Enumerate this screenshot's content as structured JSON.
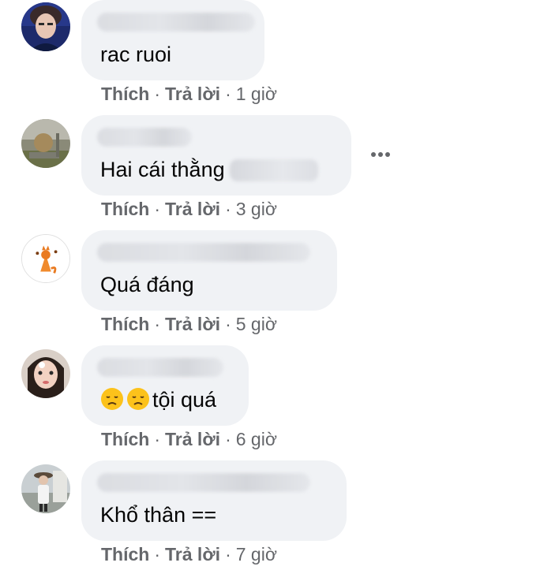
{
  "comments": [
    {
      "text": "rac ruoi",
      "like": "Thích",
      "reply": "Trả lời",
      "time": "1 giờ",
      "avatar_icon": "avatar-young-man-icon"
    },
    {
      "text": "Hai cái thằng",
      "like": "Thích",
      "reply": "Trả lời",
      "time": "3 giờ",
      "avatar_icon": "avatar-stone-sculpture-icon"
    },
    {
      "text": "Quá đáng",
      "like": "Thích",
      "reply": "Trả lời",
      "time": "5 giờ",
      "avatar_icon": "avatar-fox-drawing-icon"
    },
    {
      "text": "tội quá",
      "emoji_icons": [
        "disappointed-face-icon",
        "disappointed-face-icon"
      ],
      "like": "Thích",
      "reply": "Trả lời",
      "time": "6 giờ",
      "avatar_icon": "avatar-woman-selfie-icon"
    },
    {
      "text": "Khổ thân ==",
      "like": "Thích",
      "reply": "Trả lời",
      "time": "7 giờ",
      "avatar_icon": "avatar-person-outdoors-icon"
    }
  ],
  "more_icon": "more-options-icon",
  "colors": {
    "bubble": "#f0f2f5",
    "text": "#050505",
    "secondary": "#65676b"
  }
}
